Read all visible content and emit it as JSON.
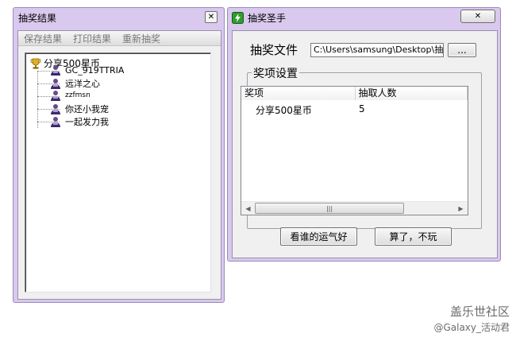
{
  "left_window": {
    "title": "抽奖结果",
    "close_glyph": "✕",
    "menu": [
      "保存结果",
      "打印结果",
      "重新抽奖"
    ],
    "tree": {
      "root_label": "分享500星币",
      "children": [
        "GC_919TTRIA",
        "远洋之心",
        "zzfmsn",
        "你还小我宠",
        "一起发力我"
      ]
    }
  },
  "right_window": {
    "title": "抽奖圣手",
    "close_glyph": "✕",
    "file_label": "抽奖文件",
    "file_path": "C:\\Users\\samsung\\Desktop\\抽奖名",
    "browse_label": "...",
    "group_title": "奖项设置",
    "columns": [
      "奖项",
      "抽取人数"
    ],
    "rows": [
      {
        "prize": "分享500星币",
        "count": "5"
      }
    ],
    "scroll_left": "◀",
    "scroll_right": "▶",
    "scroll_grip": "|||",
    "go_button": "看谁的运气好",
    "cancel_button": "算了，不玩"
  },
  "watermark": {
    "line1": "盖乐世社区",
    "line2": "@Galaxy_活动君"
  },
  "colors": {
    "frame": "#d9c9ee",
    "body": "#f0f0f0",
    "app_icon": "#2e9d2e"
  }
}
